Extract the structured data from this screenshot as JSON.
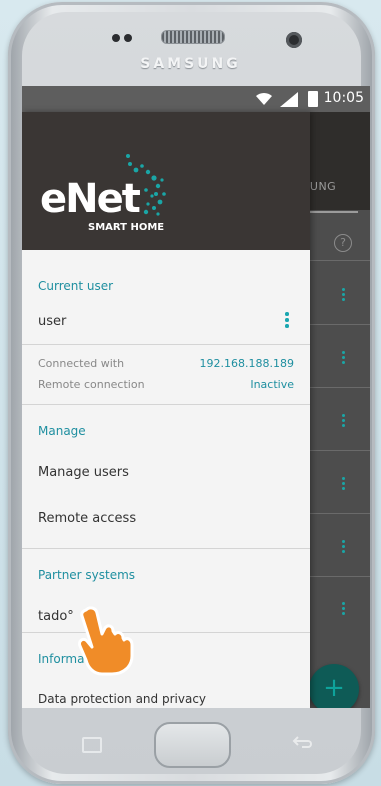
{
  "device": {
    "brand": "SAMSUNG"
  },
  "status_bar": {
    "time": "10:05"
  },
  "app": {
    "tab_label": "AUTOMATISIERUNG",
    "help_label": "?",
    "fab_label": "+"
  },
  "drawer": {
    "logo": {
      "text": "eNet",
      "subtitle": "SMART HOME"
    },
    "current_user": {
      "title": "Current user",
      "name": "user"
    },
    "connection": {
      "connected_label": "Connected with",
      "connected_value": "192.168.188.189",
      "remote_label": "Remote connection",
      "remote_value": "Inactive"
    },
    "manage": {
      "title": "Manage",
      "items": [
        "Manage users",
        "Remote access"
      ]
    },
    "partner": {
      "title": "Partner systems",
      "items": [
        "tado°"
      ]
    },
    "information": {
      "title": "Information",
      "items": [
        "Data protection and privacy"
      ]
    }
  },
  "colors": {
    "accent": "#1f8fa0",
    "header": "#3a3634",
    "fab": "#0e5b56",
    "hand": "#f08c28"
  }
}
